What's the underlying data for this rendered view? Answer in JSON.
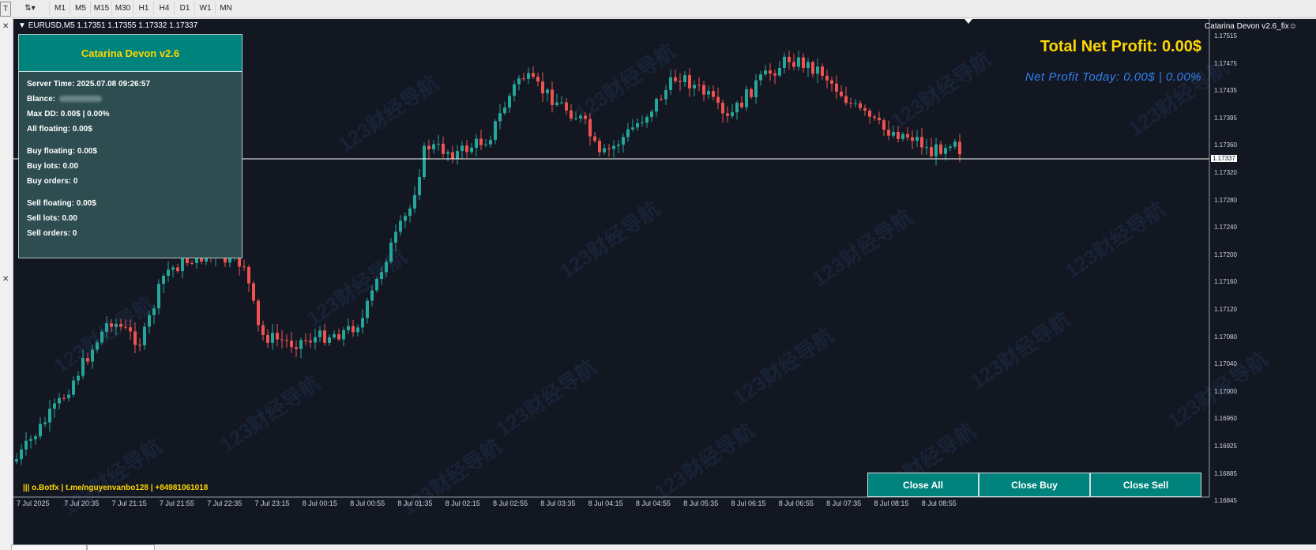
{
  "toolbar": {
    "timeframes": [
      "M1",
      "M5",
      "M15",
      "M30",
      "H1",
      "H4",
      "D1",
      "W1",
      "MN"
    ]
  },
  "chart": {
    "symbol_line": "EURUSD,M5  1.17351 1.17355 1.17332 1.17337",
    "ea_name": "Catarina Devon v2.6_fix",
    "total_net_profit": "Total Net Profit: 0.00$",
    "net_profit_today": "Net Profit Today: 0.00$ | 0.00%",
    "current_price": "1.17337",
    "footer_text": "||| o.Botfx | t.me/nguyenvanbo128 | +84981061018",
    "watermark": "123财经导航",
    "colors": {
      "bull": "#26a69a",
      "bear": "#ef5350",
      "background": "#131722",
      "accent": "#00837c",
      "gold": "#ffd700",
      "blue": "#2f80ed"
    },
    "y_ticks": [
      "1.17515",
      "1.17475",
      "1.17435",
      "1.17395",
      "1.17360",
      "1.17320",
      "1.17280",
      "1.17240",
      "1.17200",
      "1.17160",
      "1.17120",
      "1.17080",
      "1.17040",
      "1.17000",
      "1.16960",
      "1.16925",
      "1.16885",
      "1.16845"
    ],
    "x_ticks": [
      "7 Jul 2025",
      "7 Jul 20:35",
      "7 Jul 21:15",
      "7 Jul 21:55",
      "7 Jul 22:35",
      "7 Jul 23:15",
      "8 Jul 00:15",
      "8 Jul 00:55",
      "8 Jul 01:35",
      "8 Jul 02:15",
      "8 Jul 02:55",
      "8 Jul 03:35",
      "8 Jul 04:15",
      "8 Jul 04:55",
      "8 Jul 05:35",
      "8 Jul 06:15",
      "8 Jul 06:55",
      "8 Jul 07:35",
      "8 Jul 08:15",
      "8 Jul 08:55"
    ]
  },
  "panel": {
    "title": "Catarina Devon v2.6",
    "server_time": "Server Time: 2025.07.08 09:26:57",
    "balance_label": "Blance: ",
    "max_dd": "Max DD: 0.00$ | 0.00%",
    "all_floating": "All floating: 0.00$",
    "buy_floating": "Buy floating: 0.00$",
    "buy_lots": "Buy lots: 0.00",
    "buy_orders": "Buy orders: 0",
    "sell_floating": "Sell floating: 0.00$",
    "sell_lots": "Sell lots: 0.00",
    "sell_orders": "Sell orders: 0"
  },
  "buttons": {
    "close_all": "Close All",
    "close_buy": "Close Buy",
    "close_sell": "Close Sell"
  }
}
